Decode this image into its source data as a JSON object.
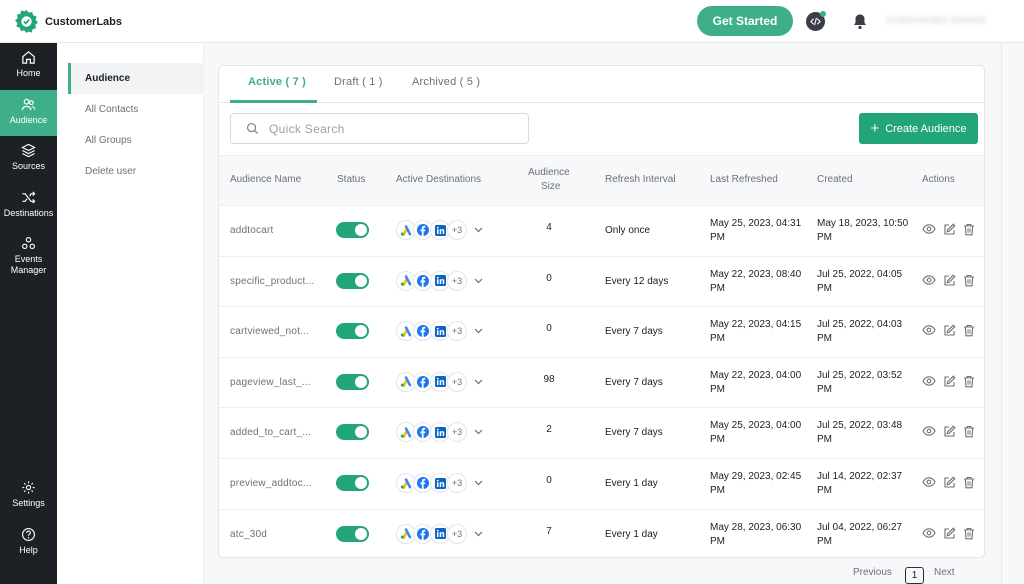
{
  "app": {
    "name": "CustomerLabs"
  },
  "header": {
    "cta_label": "Get Started",
    "user_name": "Customerlabs Deleted"
  },
  "sidebar": {
    "items": [
      {
        "label": "Home",
        "icon": "home-icon"
      },
      {
        "label": "Audience",
        "icon": "users-icon",
        "active": true
      },
      {
        "label": "Sources",
        "icon": "layers-icon"
      },
      {
        "label": "Destinations",
        "icon": "shuffle-icon"
      },
      {
        "label": "Events Manager",
        "icon": "events-icon"
      }
    ],
    "bottom": [
      {
        "label": "Settings",
        "icon": "gear-icon"
      },
      {
        "label": "Help",
        "icon": "help-icon"
      }
    ]
  },
  "subnav": {
    "items": [
      "Audience",
      "All Contacts",
      "All Groups",
      "Delete user"
    ]
  },
  "tabs": [
    {
      "label": "Active ( 7 )"
    },
    {
      "label": "Draft ( 1 )"
    },
    {
      "label": "Archived ( 5 )"
    }
  ],
  "search": {
    "placeholder": "Quick Search"
  },
  "create_button": {
    "label": "Create Audience"
  },
  "table": {
    "columns": {
      "name": "Audience Name",
      "status": "Status",
      "destinations": "Active Destinations",
      "size_line1": "Audience",
      "size_line2": "Size",
      "refresh": "Refresh Interval",
      "last": "Last Refreshed",
      "created": "Created",
      "actions": "Actions"
    },
    "rows": [
      {
        "name": "addtocart",
        "more": "+3",
        "size": "4",
        "refresh": "Only once",
        "last": "May 25, 2023, 04:31 PM",
        "created": "May 18, 2023, 10:50 PM"
      },
      {
        "name": "specific_product...",
        "more": "+3",
        "size": "0",
        "refresh": "Every 12 days",
        "last": "May 22, 2023, 08:40 PM",
        "created": "Jul 25, 2022, 04:05 PM"
      },
      {
        "name": "cartviewed_not...",
        "more": "+3",
        "size": "0",
        "refresh": "Every 7 days",
        "last": "May 22, 2023, 04:15 PM",
        "created": "Jul 25, 2022, 04:03 PM"
      },
      {
        "name": "pageview_last_...",
        "more": "+3",
        "size": "98",
        "refresh": "Every 7 days",
        "last": "May 22, 2023, 04:00 PM",
        "created": "Jul 25, 2022, 03:52 PM"
      },
      {
        "name": "added_to_cart_...",
        "more": "+3",
        "size": "2",
        "refresh": "Every 7 days",
        "last": "May 25, 2023, 04:00 PM",
        "created": "Jul 25, 2022, 03:48 PM"
      },
      {
        "name": "preview_addtoc...",
        "more": "+3",
        "size": "0",
        "refresh": "Every 1 day",
        "last": "May 29, 2023, 02:45 PM",
        "created": "Jul 14, 2022, 02:37 PM"
      },
      {
        "name": "atc_30d",
        "more": "+3",
        "size": "7",
        "refresh": "Every 1 day",
        "last": "May 28, 2023, 06:30 PM",
        "created": "Jul 04, 2022, 06:27 PM"
      }
    ]
  },
  "pagination": {
    "previous": "Previous",
    "current": "1",
    "next": "Next"
  },
  "colors": {
    "accent": "#22a57a",
    "sidebar_bg": "#1d2126",
    "cta": "#3fae8a"
  }
}
